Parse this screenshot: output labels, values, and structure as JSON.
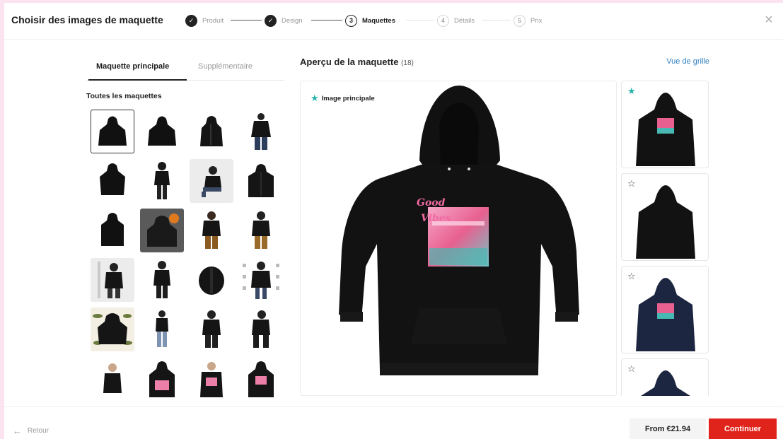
{
  "header": {
    "title": "Choisir des images de maquette",
    "steps": [
      {
        "number": "1",
        "label": "Produit",
        "state": "done"
      },
      {
        "number": "2",
        "label": "Design",
        "state": "done"
      },
      {
        "number": "3",
        "label": "Maquettes",
        "state": "current"
      },
      {
        "number": "4",
        "label": "Détails",
        "state": "todo"
      },
      {
        "number": "5",
        "label": "Prix",
        "state": "todo"
      }
    ],
    "close_icon": "close-icon"
  },
  "left": {
    "tabs": [
      "Maquette principale",
      "Supplémentaire"
    ],
    "active_tab": 0,
    "section_title": "Toutes les maquettes"
  },
  "center": {
    "title": "Aperçu de la maquette",
    "count": "(18)",
    "grid_link": "Vue de grille",
    "main_label": "Image principale",
    "design_text_line1": "Good",
    "design_text_line2": "Vibes"
  },
  "strip": {
    "items": [
      {
        "starred": true,
        "color": "black",
        "has_design": true
      },
      {
        "starred": false,
        "color": "black",
        "has_design": false
      },
      {
        "starred": false,
        "color": "navy",
        "has_design": true
      },
      {
        "starred": false,
        "color": "navy",
        "has_design": false
      }
    ]
  },
  "footer": {
    "back_label": "Retour",
    "price_label": "From €21.94",
    "continue_label": "Continuer"
  },
  "colors": {
    "accent_red": "#e0241b",
    "teal_star": "#26b3ad",
    "link_blue": "#2f7fbf"
  }
}
